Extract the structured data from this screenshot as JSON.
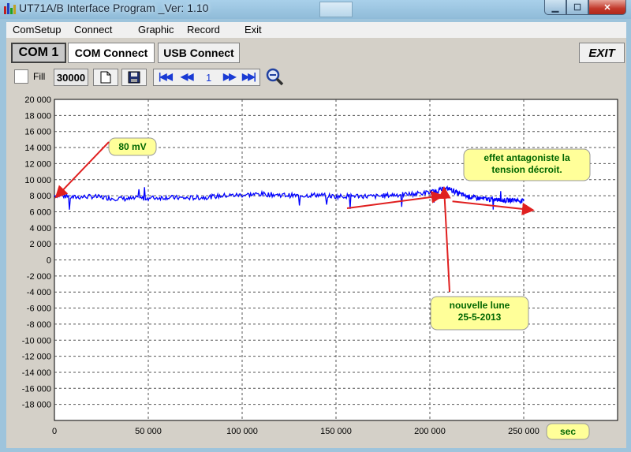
{
  "window": {
    "title": "UT71A/B Interface Program _Ver: 1.10"
  },
  "menu": {
    "items": [
      "ComSetup",
      "Connect",
      "Graphic",
      "Record",
      "Exit"
    ]
  },
  "toolbar": {
    "com_port": "COM 1",
    "com_connect": "COM Connect",
    "usb_connect": "USB Connect",
    "exit": "EXIT",
    "fill_label": "Fill",
    "sample_count": "30000",
    "page": "1"
  },
  "icons": [
    "app-icon",
    "new-file-icon",
    "save-icon",
    "first-page-icon",
    "previous-page-icon",
    "next-page-icon",
    "last-page-icon",
    "zoom-icon"
  ],
  "colors": {
    "series": "#0000ff",
    "annotation_bg": "#ffff99",
    "annotation_text": "#006600",
    "arrow": "#e02020"
  },
  "chart_data": {
    "type": "line",
    "xlabel": "sec",
    "ylabel": "",
    "xlim": [
      0,
      300000
    ],
    "ylim": [
      -20000,
      20000
    ],
    "x_ticks": [
      "0",
      "50 000",
      "100 000",
      "150 000",
      "200 000",
      "250 000"
    ],
    "y_ticks": [
      "20 000",
      "18 000",
      "16 000",
      "14 000",
      "12 000",
      "10 000",
      "8 000",
      "6 000",
      "4 000",
      "2 000",
      "0",
      "-2 000",
      "-4 000",
      "-6 000",
      "-8 000",
      "-10 000",
      "-12 000",
      "-14 000",
      "-16 000",
      "-18 000"
    ],
    "grid": true,
    "series": [
      {
        "x": [
          0,
          10000,
          20000,
          30000,
          40000,
          50000,
          60000,
          70000,
          80000,
          90000,
          100000,
          110000,
          120000,
          130000,
          140000,
          150000,
          160000,
          170000,
          180000,
          190000,
          200000,
          205000,
          210000,
          215000,
          220000,
          225000,
          230000,
          235000,
          240000,
          245000,
          250000
        ],
        "y": [
          8100,
          7800,
          7900,
          7700,
          7600,
          7700,
          7800,
          7700,
          7800,
          8000,
          8100,
          8200,
          8100,
          8000,
          8100,
          7900,
          8000,
          7900,
          8100,
          8200,
          8400,
          8700,
          8900,
          8300,
          7900,
          7700,
          7600,
          7500,
          7400,
          7500,
          7300
        ]
      }
    ],
    "annotations": [
      {
        "text": "80 mV"
      },
      {
        "lines": [
          "effet antagoniste la",
          "tension décroit."
        ]
      },
      {
        "lines": [
          "nouvelle lune",
          "25-5-2013"
        ]
      }
    ]
  }
}
